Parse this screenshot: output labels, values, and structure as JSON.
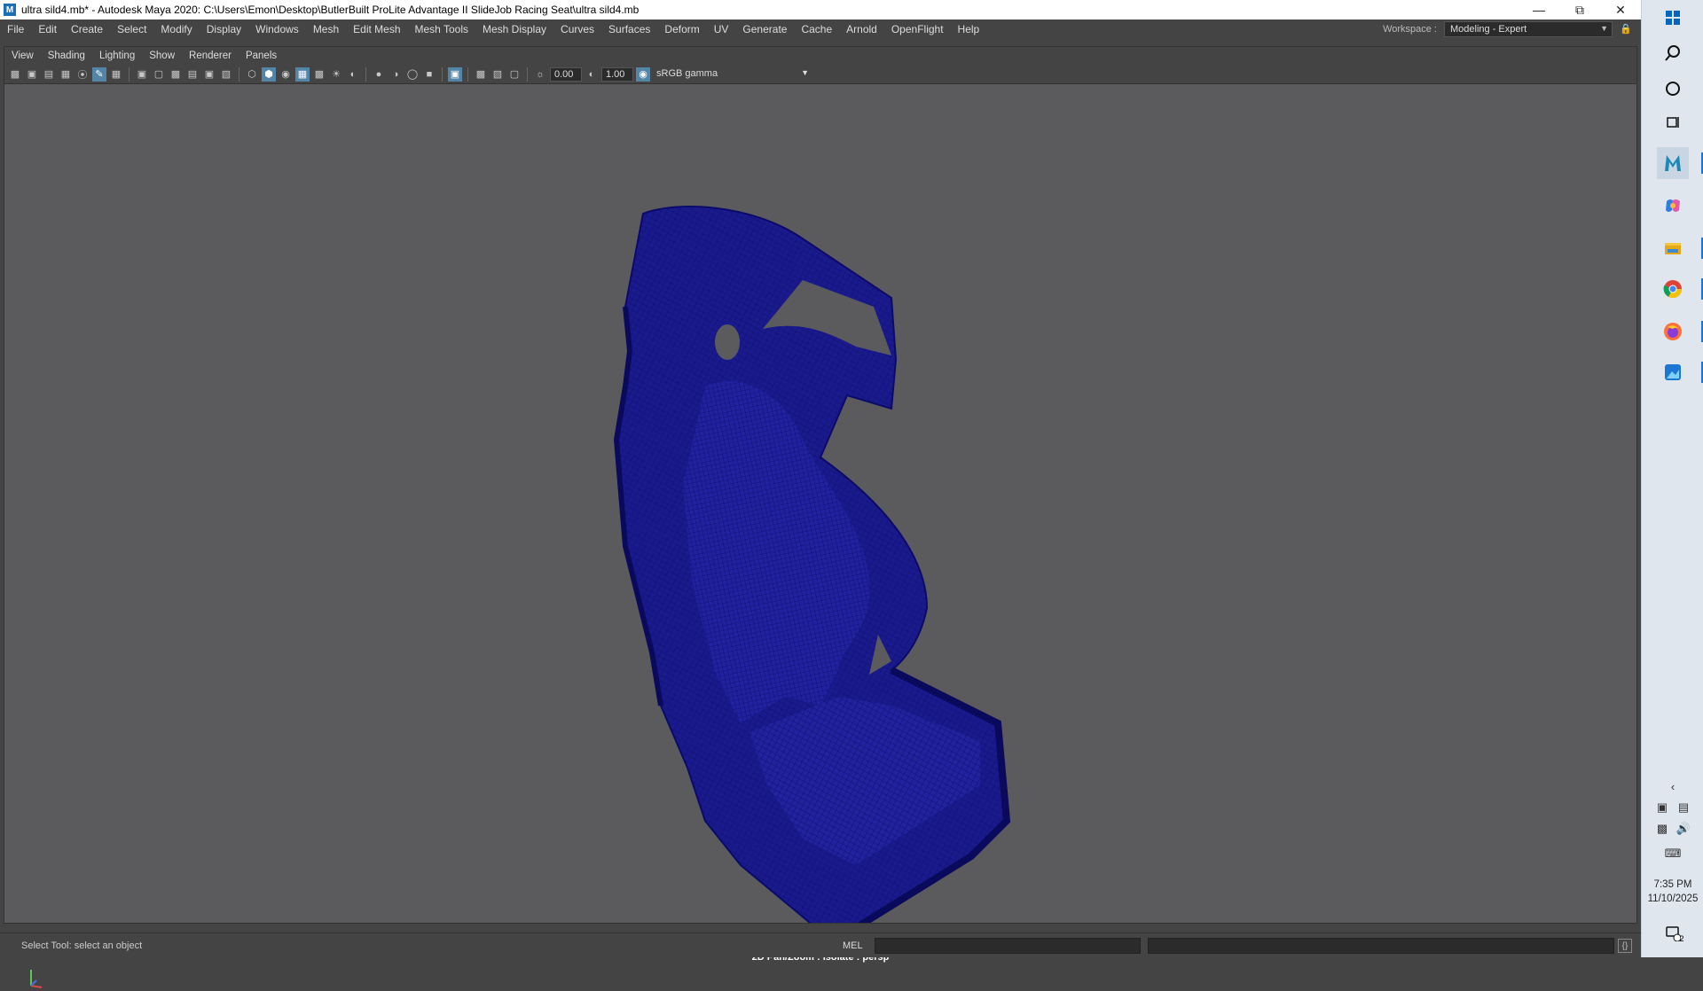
{
  "window": {
    "title": "ultra sild4.mb* - Autodesk Maya 2020: C:\\Users\\Emon\\Desktop\\ButlerBuilt ProLite Advantage II SlideJob Racing Seat\\ultra sild4.mb",
    "logo_letter": "M",
    "minimize_icon": "minimize-icon",
    "restore_icon": "restore-icon",
    "close_icon": "close-icon"
  },
  "menubar": {
    "items": [
      "File",
      "Edit",
      "Create",
      "Select",
      "Modify",
      "Display",
      "Windows",
      "Mesh",
      "Edit Mesh",
      "Mesh Tools",
      "Mesh Display",
      "Curves",
      "Surfaces",
      "Deform",
      "UV",
      "Generate",
      "Cache",
      "Arnold",
      "OpenFlight",
      "Help"
    ]
  },
  "workspace": {
    "label": "Workspace :",
    "value": "Modeling - Expert"
  },
  "viewport": {
    "menu": [
      "View",
      "Shading",
      "Lighting",
      "Show",
      "Renderer",
      "Panels"
    ],
    "exposure": "0.00",
    "gamma": "1.00",
    "color_space": "sRGB gamma",
    "hud": "2D Pan/Zoom : Isolate : persp",
    "mesh_color": "#1a1a8c",
    "background_color": "#5b5b5e"
  },
  "statusbar": {
    "help_line": "Select Tool: select an object",
    "command_lang": "MEL"
  },
  "taskbar": {
    "apps": [
      "windows-start-icon",
      "search-icon",
      "cortana-icon",
      "task-view-icon",
      "maya-icon",
      "copilot-icon",
      "file-explorer-icon",
      "chrome-icon",
      "firefox-icon",
      "photos-icon"
    ],
    "time": "7:35 PM",
    "date": "11/10/2025",
    "notifications_count": "2"
  }
}
